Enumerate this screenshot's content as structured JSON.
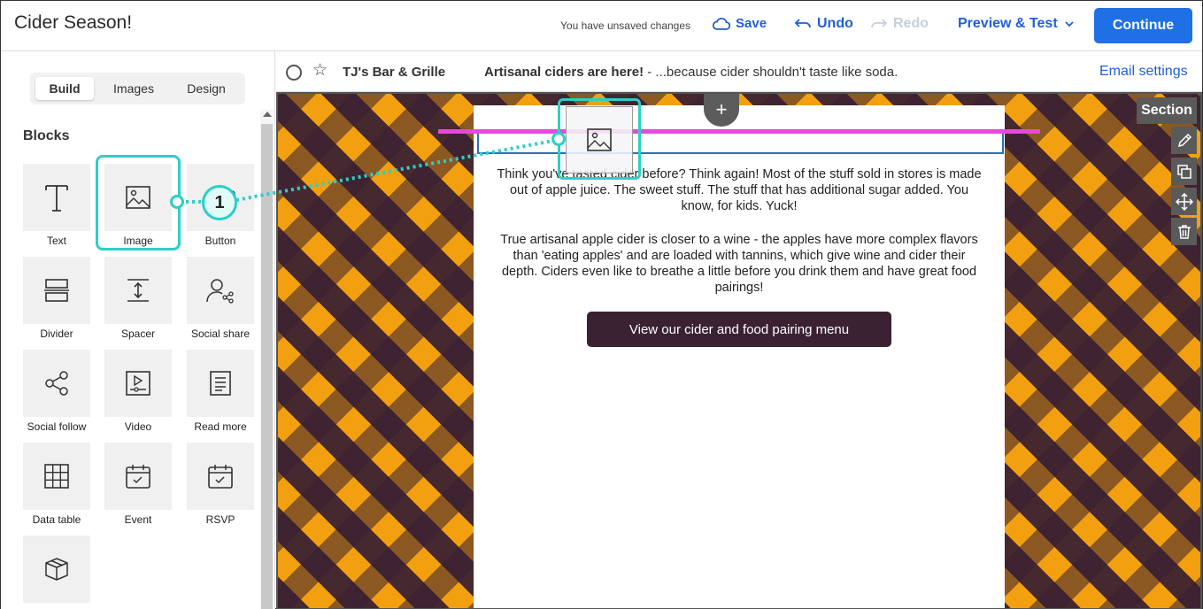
{
  "app": {
    "title": "Cider Season!"
  },
  "toolbar": {
    "status": "You have unsaved changes",
    "save_label": "Save",
    "undo_label": "Undo",
    "redo_label": "Redo",
    "preview_label": "Preview & Test",
    "continue_label": "Continue",
    "accent": "#1f6fe5"
  },
  "sidebar": {
    "tabs": [
      {
        "label": "Build",
        "active": true
      },
      {
        "label": "Images",
        "active": false
      },
      {
        "label": "Design",
        "active": false
      }
    ],
    "heading": "Blocks",
    "blocks": [
      {
        "label": "Text",
        "icon": "text-icon"
      },
      {
        "label": "Image",
        "icon": "image-icon"
      },
      {
        "label": "Button",
        "icon": "button-icon"
      },
      {
        "label": "Divider",
        "icon": "divider-icon"
      },
      {
        "label": "Spacer",
        "icon": "spacer-icon"
      },
      {
        "label": "Social share",
        "icon": "social-share-icon"
      },
      {
        "label": "Social follow",
        "icon": "social-follow-icon"
      },
      {
        "label": "Video",
        "icon": "video-icon"
      },
      {
        "label": "Read more",
        "icon": "read-more-icon"
      },
      {
        "label": "Data table",
        "icon": "data-table-icon"
      },
      {
        "label": "Event",
        "icon": "event-icon"
      },
      {
        "label": "RSVP",
        "icon": "rsvp-icon"
      },
      {
        "label": "",
        "icon": "product-box-icon"
      }
    ]
  },
  "email": {
    "from_name": "TJ's Bar & Grille",
    "subject": "Artisanal ciders are here!",
    "preheader": " - ...because cider shouldn't taste like soda.",
    "settings_label": "Email settings",
    "paragraph1": "Think you've tasted cider before? Think again! Most of the stuff sold in stores is made out of apple juice. The sweet stuff. The stuff that has additional sugar added. You know, for kids. Yuck!",
    "paragraph2": "True artisanal apple cider is closer to a wine - the apples have more complex flavors than 'eating apples' and are loaded with tannins, which give wine and cider their depth. Ciders even like to breathe a little before you drink them and have great food pairings!",
    "cta_label": "View our cider and food pairing menu",
    "cta_color": "#3b2233"
  },
  "canvas": {
    "section_label": "Section",
    "add_label": "+",
    "tools": [
      "edit-icon",
      "duplicate-icon",
      "move-icon",
      "delete-icon"
    ]
  },
  "annotation": {
    "step": "1",
    "color": "#2ccfc6"
  }
}
